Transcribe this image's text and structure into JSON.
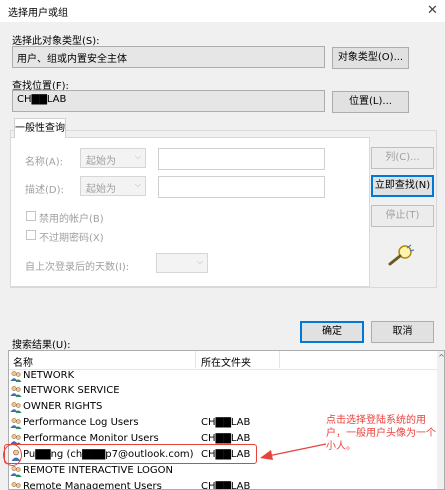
{
  "window": {
    "title": "选择用户或组",
    "close_glyph": "✕"
  },
  "object_type": {
    "label": "选择此对象类型(S):",
    "value": "用户、组或内置安全主体",
    "button": "对象类型(O)..."
  },
  "location": {
    "label": "查找位置(F):",
    "value": "CH▇▇LAB",
    "button": "位置(L)..."
  },
  "query": {
    "tab_label": "一般性查询",
    "name_label": "名称(A):",
    "name_mode": "起始为",
    "desc_label": "描述(D):",
    "desc_mode": "起始为",
    "disabled_accounts": "禁用的帐户(B)",
    "non_expiring_pwd": "不过期密码(X)",
    "days_since_logon": "自上次登录后的天数(I):",
    "columns_button": "列(C)...",
    "find_now_button": "立即查找(N)",
    "stop_button": "停止(T)"
  },
  "actions": {
    "ok": "确定",
    "cancel": "取消"
  },
  "results": {
    "label": "搜索结果(U):",
    "columns": [
      "名称",
      "所在文件夹"
    ],
    "rows": [
      {
        "name": "NETWORK",
        "folder": "",
        "icon": "group-icon"
      },
      {
        "name": "NETWORK SERVICE",
        "folder": "",
        "icon": "group-icon"
      },
      {
        "name": "OWNER RIGHTS",
        "folder": "",
        "icon": "group-icon"
      },
      {
        "name": "Performance Log Users",
        "folder": "CH▇▇LAB",
        "icon": "group-icon"
      },
      {
        "name": "Performance Monitor Users",
        "folder": "CH▇▇LAB",
        "icon": "group-icon"
      },
      {
        "name": "Pu▇▇ng (ch▇▇▇p7@outlook.com)",
        "folder": "CH▇▇LAB",
        "icon": "user-icon"
      },
      {
        "name": "REMOTE INTERACTIVE LOGON",
        "folder": "",
        "icon": "group-icon"
      },
      {
        "name": "Remote Management Users",
        "folder": "CH▇▇LAB",
        "icon": "group-icon"
      }
    ]
  },
  "annotation": {
    "text": "点击选择登陆系统的用户，一般用户头像为一个小人。",
    "color": "#e8423c"
  },
  "colors": {
    "dialog_bg": "#f0f0f0",
    "accent": "#0078d7"
  }
}
